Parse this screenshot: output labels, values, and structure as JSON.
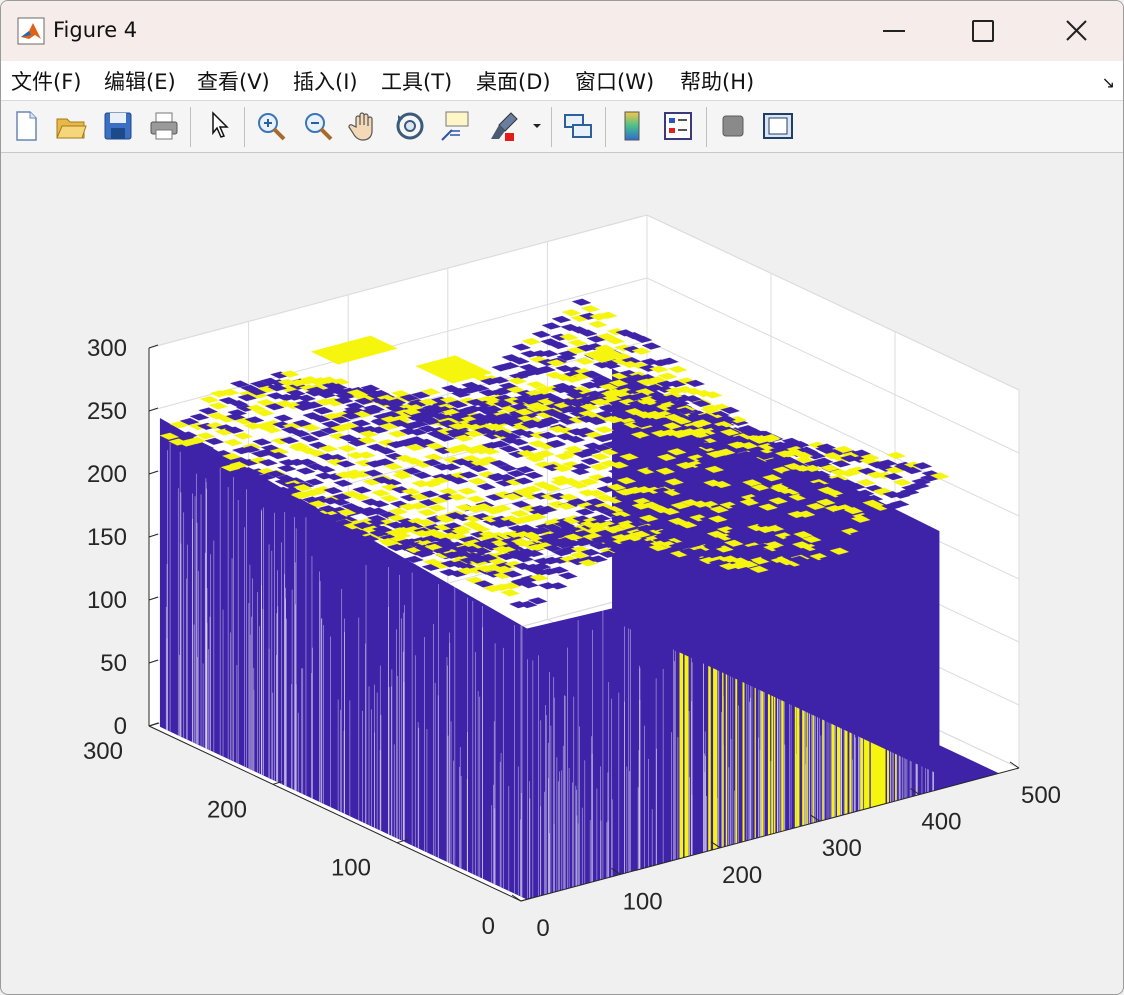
{
  "window": {
    "title": "Figure 4"
  },
  "menu": [
    "文件(F)",
    "编辑(E)",
    "查看(V)",
    "插入(I)",
    "工具(T)",
    "桌面(D)",
    "窗口(W)",
    "帮助(H)"
  ],
  "menu_dock_glyph": "↘",
  "toolbar": [
    "new-file-icon",
    "open-folder-icon",
    "save-icon",
    "print-icon",
    "pointer-icon",
    "zoom-in-icon",
    "zoom-out-icon",
    "pan-hand-icon",
    "rotate-3d-icon",
    "data-cursor-icon",
    "brush-icon",
    "link-plot-icon",
    "colorbar-icon",
    "legend-icon",
    "hide-plot-tools-icon",
    "show-plot-tools-icon"
  ],
  "colors": {
    "surface_low": "#3e22a8",
    "surface_high": "#f5f50e",
    "panel": "#f0f0f0",
    "axis_bg": "#ffffff"
  },
  "chart_data": {
    "type": "surface",
    "view": "3d",
    "z_ticks": [
      0,
      50,
      100,
      150,
      200,
      250,
      300
    ],
    "x_ticks": [
      0,
      100,
      200,
      300,
      400,
      500
    ],
    "y_ticks": [
      0,
      100,
      200,
      300
    ],
    "x_range": [
      0,
      500
    ],
    "y_range": [
      0,
      300
    ],
    "z_range": [
      0,
      300
    ],
    "grid": true,
    "base_level": 0,
    "top_level_range": [
      200,
      255
    ]
  }
}
